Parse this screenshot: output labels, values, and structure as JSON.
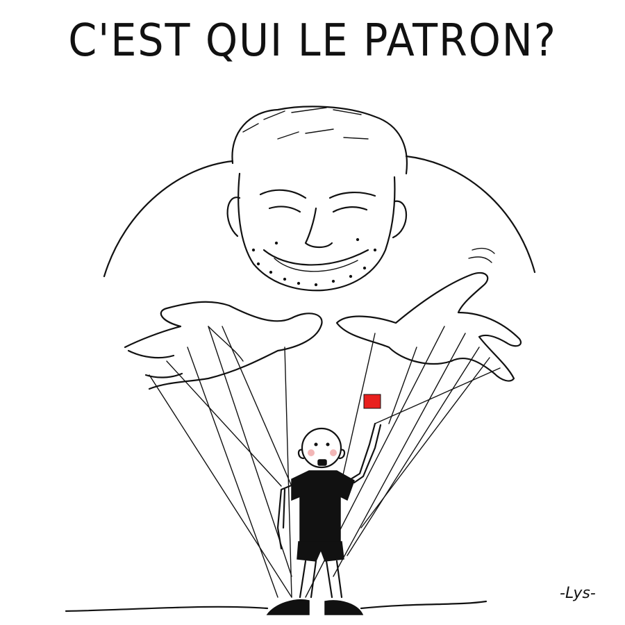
{
  "caption": "C'EST QUI LE PATRON?",
  "signature": "-Lys-",
  "colors": {
    "ink": "#111111",
    "background": "#ffffff",
    "red_card": "#e8201e"
  }
}
